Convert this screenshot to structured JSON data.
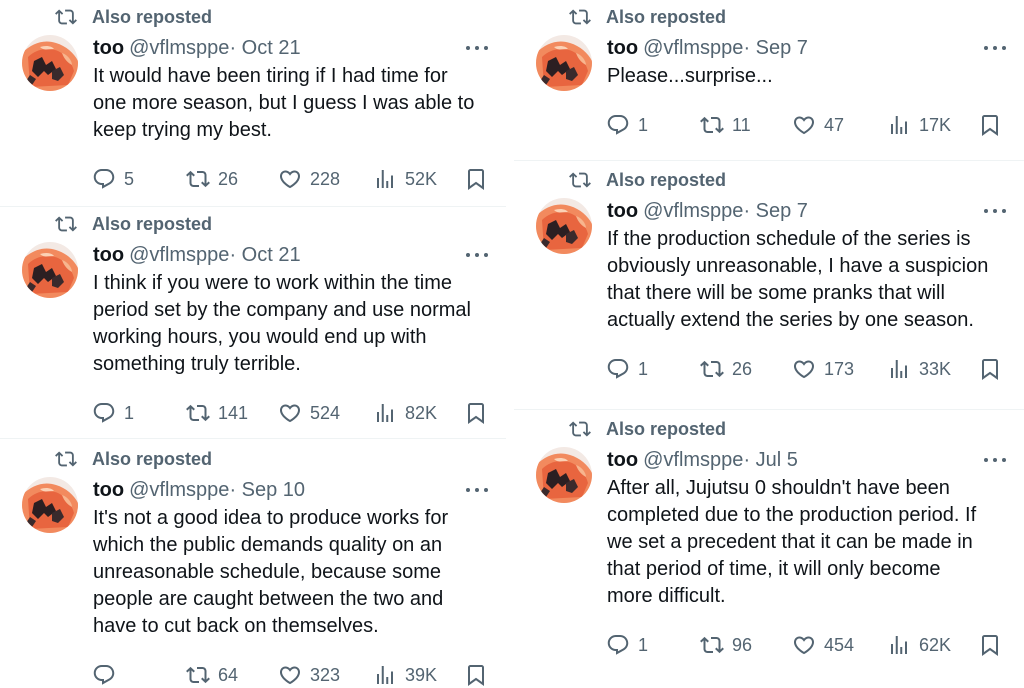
{
  "repost_label": "Also reposted",
  "author": {
    "name": "too",
    "handle": "@vflmsppe"
  },
  "left": [
    {
      "date": "Oct 21",
      "lines": [
        "It would have been tiring if I had time for",
        "one more season, but I guess I was able to",
        "keep trying my best."
      ],
      "replies": "5",
      "reposts": "26",
      "likes": "228",
      "views": "52K"
    },
    {
      "date": "Oct 21",
      "lines": [
        "I think if you were to work within the time",
        "period set by the company and use normal",
        "working hours, you would end up with",
        "something truly terrible."
      ],
      "replies": "1",
      "reposts": "141",
      "likes": "524",
      "views": "82K"
    },
    {
      "date": "Sep 10",
      "lines": [
        "It's not a good idea to produce works for",
        "which the public demands quality on an",
        "unreasonable schedule, because some",
        "people are caught between the two and",
        "have to cut back on themselves."
      ],
      "replies": "",
      "reposts": "64",
      "likes": "323",
      "views": "39K"
    }
  ],
  "right": [
    {
      "date": "Sep 7",
      "lines": [
        "Please...surprise..."
      ],
      "replies": "1",
      "reposts": "11",
      "likes": "47",
      "views": "17K"
    },
    {
      "date": "Sep 7",
      "lines": [
        "If the production schedule of the series is",
        "obviously unreasonable, I have a suspicion",
        "that there will be some pranks that will",
        "actually extend the series by one season."
      ],
      "replies": "1",
      "reposts": "26",
      "likes": "173",
      "views": "33K"
    },
    {
      "date": "Jul 5",
      "lines": [
        "After all, Jujutsu 0 shouldn't have been",
        "completed due to the production period. If",
        "we set a precedent that it can be made in",
        "that period of time, it will only become",
        "more difficult."
      ],
      "replies": "1",
      "reposts": "96",
      "likes": "454",
      "views": "62K"
    }
  ]
}
